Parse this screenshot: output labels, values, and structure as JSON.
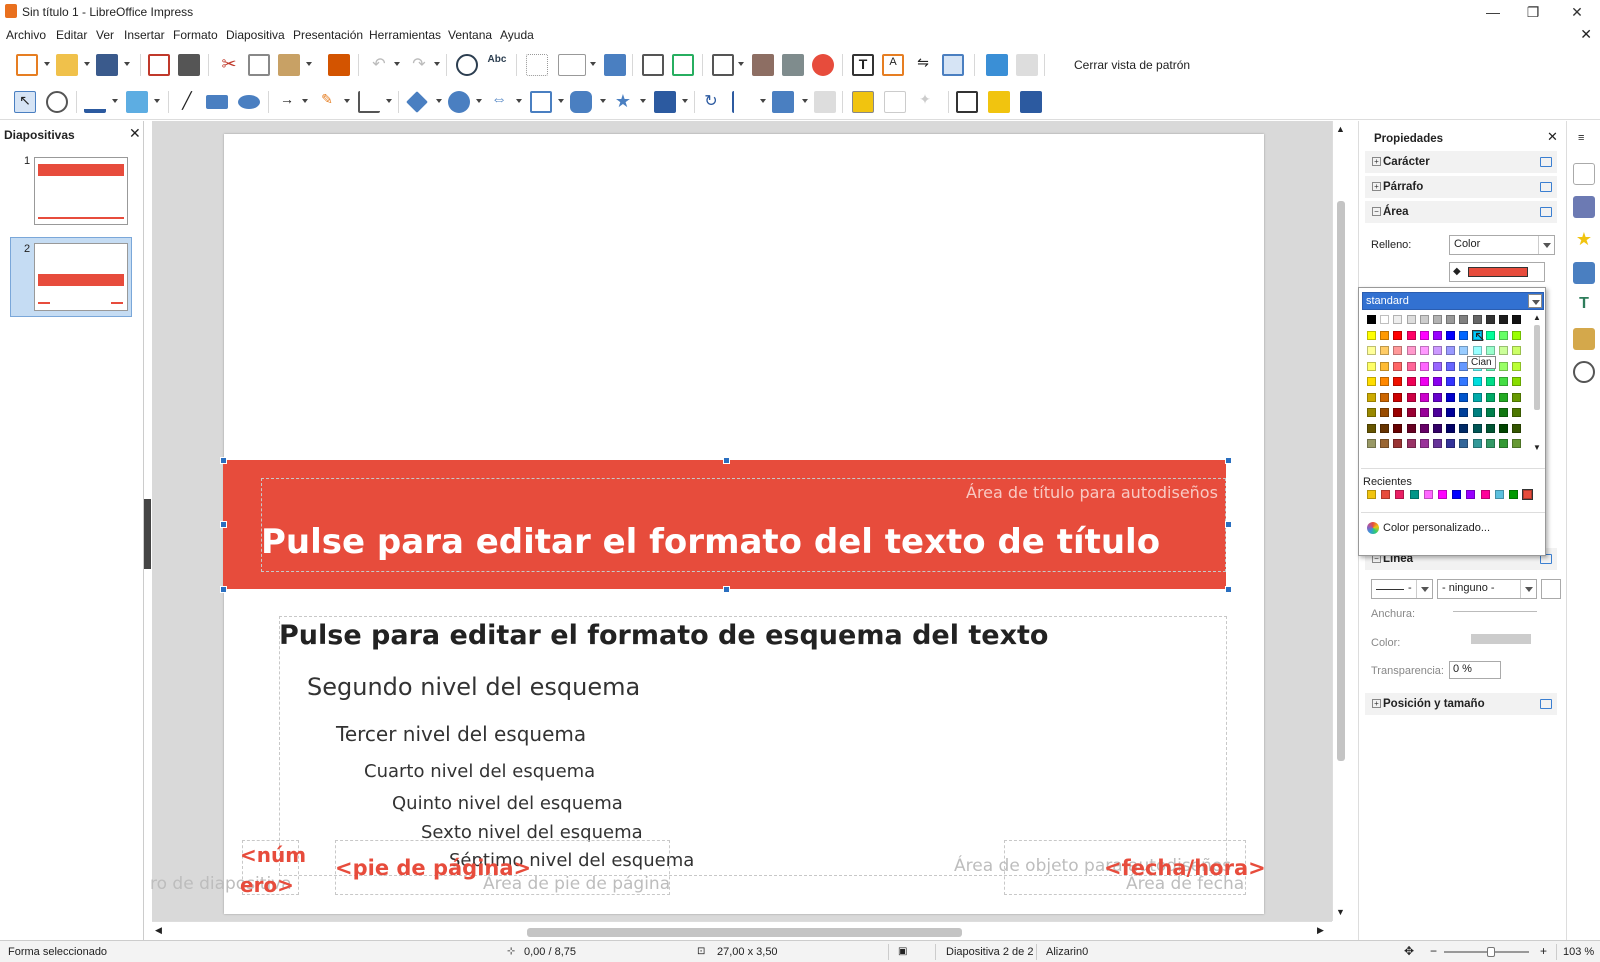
{
  "window": {
    "title": "Sin título 1 - LibreOffice Impress",
    "minimize": "—",
    "restore": "❐",
    "close": "✕"
  },
  "menu": {
    "items": [
      "Archivo",
      "Editar",
      "Ver",
      "Insertar",
      "Formato",
      "Diapositiva",
      "Presentación",
      "Herramientas",
      "Ventana",
      "Ayuda"
    ],
    "close_doc": "✕"
  },
  "toolbar": {
    "close_master": "Cerrar vista de patrón"
  },
  "slides_panel": {
    "title": "Diapositivas",
    "close": "✕",
    "thumbs": [
      {
        "num": "1"
      },
      {
        "num": "2"
      }
    ]
  },
  "slide": {
    "title_area_label": "Área de título para autodiseños",
    "title_text": "Pulse para editar el formato del texto de título",
    "outline": [
      "Pulse para editar el formato de esquema del texto",
      "Segundo nivel del esquema",
      "Tercer nivel del esquema",
      "Cuarto nivel del esquema",
      "Quinto nivel del esquema",
      "Sexto nivel del esquema",
      "Séptimo nivel del esquema"
    ],
    "num_line1": "<núm",
    "num_line2": "ero>",
    "num_area_fragment": "ro de diapositiva",
    "footer_field": "<pie de página>",
    "footer_area": "Área de pie de página",
    "object_area": "Área de objeto para autodiseños",
    "date_field": "<fecha/hora>",
    "date_area": "Área de fecha"
  },
  "sidebar": {
    "title": "Propiedades",
    "close": "✕",
    "sections": {
      "caracter": "Carácter",
      "parrafo": "Párrafo",
      "area": "Área",
      "linea": "Línea",
      "posicion": "Posición y tamaño"
    },
    "fill_label": "Relleno:",
    "fill_value": "Color",
    "fill_color": "#e74c3c",
    "line_width_label": "Anchura:",
    "line_color_label": "Color:",
    "line_transp_label": "Transparencia:",
    "line_transp_value": "0 %",
    "line_arrow_value": "- ninguno -",
    "line_style_value": "-"
  },
  "palette": {
    "selected": "standard",
    "tooltip": "Cian",
    "recent_label": "Recientes",
    "custom_label": "Color personalizado...",
    "rows": [
      [
        "#000000",
        "#ffffff",
        "#eeeeee",
        "#dddddd",
        "#cccccc",
        "#b2b2b2",
        "#999999",
        "#808080",
        "#666666",
        "#333333",
        "#1c1c1c",
        "#111111"
      ],
      [
        "#ffff00",
        "#ff9900",
        "#ff0000",
        "#ff0066",
        "#ff00ff",
        "#9900ff",
        "#0000ff",
        "#0066ff",
        "#00ccff",
        "#00ff99",
        "#66ff66",
        "#99ff00"
      ],
      [
        "#ffff99",
        "#ffcc66",
        "#ff9999",
        "#ff99cc",
        "#ff99ff",
        "#cc99ff",
        "#9999ff",
        "#99ccff",
        "#99ffff",
        "#99ffcc",
        "#ccff99",
        "#ccff66"
      ],
      [
        "#ffff66",
        "#ffbb33",
        "#ff6666",
        "#ff6699",
        "#ff66ff",
        "#9966ff",
        "#6666ff",
        "#6699ff",
        "#66ffff",
        "#66ffbb",
        "#99ff66",
        "#bbff33"
      ],
      [
        "#ffdd00",
        "#ff8800",
        "#ee1100",
        "#ee0055",
        "#ee00ee",
        "#8800ee",
        "#3333ff",
        "#3377ff",
        "#00dddd",
        "#00dd88",
        "#44dd44",
        "#88dd00"
      ],
      [
        "#ccaa00",
        "#cc6600",
        "#cc0000",
        "#cc0044",
        "#cc00cc",
        "#6600cc",
        "#0000cc",
        "#0055cc",
        "#00aaaa",
        "#00aa66",
        "#22aa22",
        "#669900"
      ],
      [
        "#998800",
        "#994c00",
        "#990000",
        "#990033",
        "#990099",
        "#4c0099",
        "#000099",
        "#004099",
        "#008080",
        "#00804c",
        "#117711",
        "#4c7700"
      ],
      [
        "#665500",
        "#663300",
        "#660000",
        "#660022",
        "#660066",
        "#330066",
        "#000066",
        "#002a66",
        "#005555",
        "#005533",
        "#004400",
        "#335500"
      ],
      [
        "#999966",
        "#996633",
        "#993333",
        "#993366",
        "#993399",
        "#663399",
        "#333399",
        "#336699",
        "#339999",
        "#339966",
        "#339933",
        "#669933"
      ]
    ],
    "recent": [
      "#f1c40f",
      "#e74c3c",
      "#e91e63",
      "#009688",
      "#ff66ff",
      "#ff00ff",
      "#0000ff",
      "#9900ff",
      "#ff0099",
      "#5bc0de",
      "#009900",
      "#e74c3c"
    ]
  },
  "status": {
    "mode": "Forma seleccionado",
    "position": "0,00 / 8,75",
    "size": "27,00 x 3,50",
    "slide": "Diapositiva 2 de 2",
    "master": "Alizarin0",
    "zoom": "103 %"
  }
}
